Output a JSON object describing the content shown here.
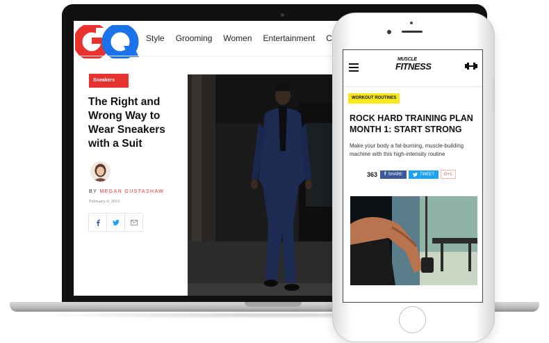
{
  "gq": {
    "logo": "GQ",
    "nav": [
      "Style",
      "Grooming",
      "Women",
      "Entertainment",
      "Cultur"
    ],
    "tag": "Sneakers",
    "title": "The Right and Wrong Way to Wear Sneakers with a Suit",
    "by_prefix": "BY ",
    "author": "MEGAN GUSTASHAW",
    "date": "February 4, 2016",
    "share_icons": [
      "facebook-icon",
      "twitter-icon",
      "email-icon"
    ]
  },
  "mf": {
    "logo_top": "MUSCLE",
    "logo_main": "FITNESS",
    "tag": "WORKOUT ROUTINES",
    "title": "ROCK HARD TRAINING PLAN MONTH 1: START STRONG",
    "description": "Make your body a fat-burning, muscle-building machine with this high-intensity routine",
    "share_count": "363",
    "fb_label": "SHARE",
    "tw_label": "TWEET",
    "gp_label": "G+1"
  },
  "colors": {
    "gq_red": "#e8322d",
    "gq_blue": "#1a73e8",
    "mf_yellow": "#f8e71c",
    "facebook": "#3b5998",
    "twitter": "#1da1f2"
  }
}
